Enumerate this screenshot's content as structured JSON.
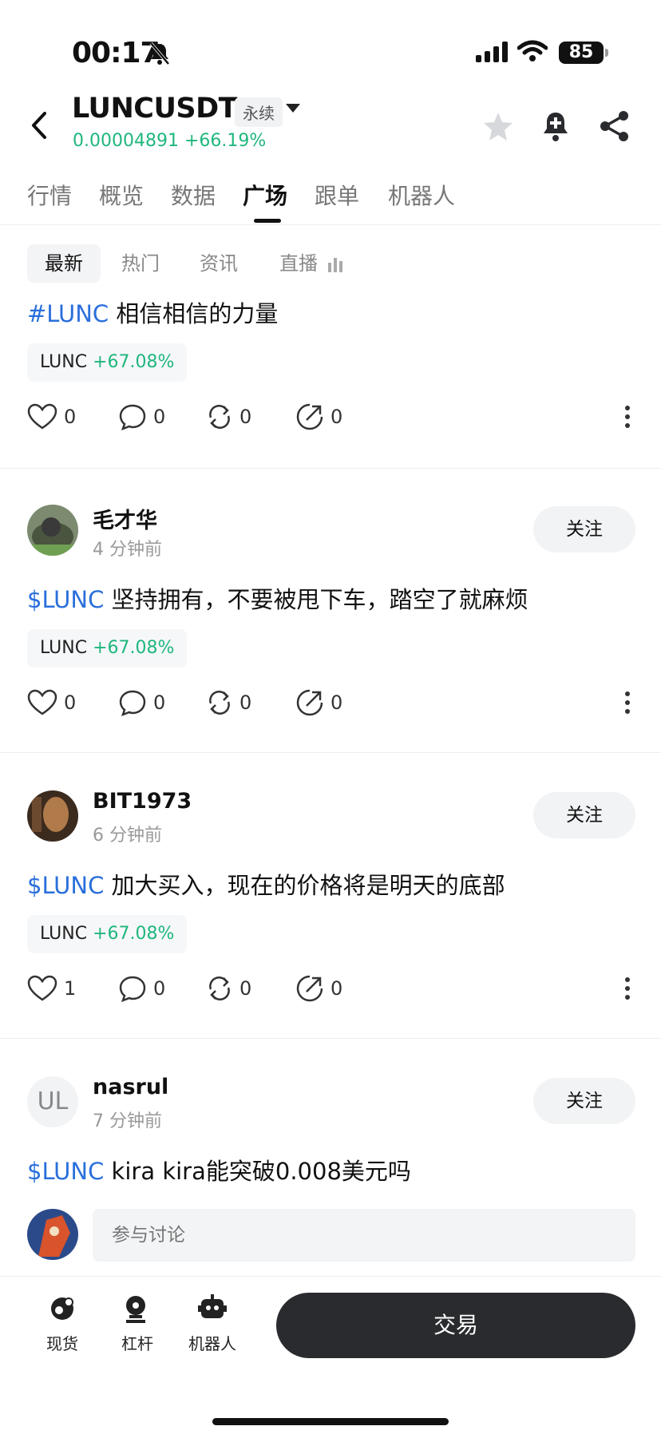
{
  "status_bar": {
    "time": "00:17",
    "battery": "85"
  },
  "header": {
    "pair": "LUNCUSDT",
    "badge": "永续",
    "price": "0.00004891",
    "change": "+66.19%"
  },
  "main_tabs": [
    "行情",
    "概览",
    "数据",
    "广场",
    "跟单",
    "机器人"
  ],
  "sub_tabs": [
    "最新",
    "热门",
    "资讯",
    "直播"
  ],
  "posts": [
    {
      "tag": "#LUNC",
      "text": " 相信相信的力量",
      "chip_coin": "LUNC",
      "chip_change": "+67.08%",
      "likes": "0",
      "comments": "0",
      "reposts": "0",
      "shares": "0"
    },
    {
      "author": "毛才华",
      "time": "4 分钟前",
      "follow": "关注",
      "tag": "$LUNC",
      "text": " 坚持拥有，不要被甩下车，踏空了就麻烦",
      "chip_coin": "LUNC",
      "chip_change": "+67.08%",
      "likes": "0",
      "comments": "0",
      "reposts": "0",
      "shares": "0"
    },
    {
      "author": "BIT1973",
      "time": "6 分钟前",
      "follow": "关注",
      "tag": "$LUNC",
      "text": " 加大买入，现在的价格将是明天的底部",
      "chip_coin": "LUNC",
      "chip_change": "+67.08%",
      "likes": "1",
      "comments": "0",
      "reposts": "0",
      "shares": "0"
    },
    {
      "author": "nasrul",
      "time": "7 分钟前",
      "follow": "关注",
      "avatar_initials": "UL",
      "tag": "$LUNC",
      "text": " kira kira能突破0.008美元吗"
    }
  ],
  "comment": {
    "placeholder": "参与讨论"
  },
  "bottom_bar": {
    "spot": "现货",
    "leverage": "杠杆",
    "bot": "机器人",
    "trade": "交易"
  }
}
